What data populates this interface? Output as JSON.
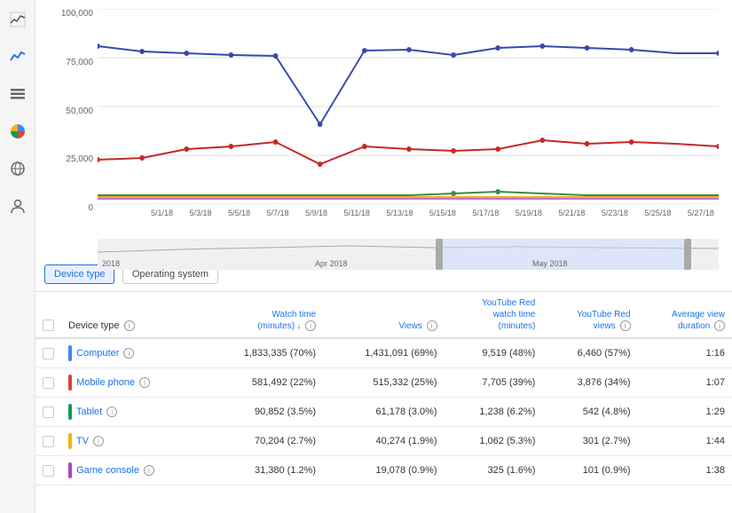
{
  "sidebar": {
    "icons": [
      {
        "name": "chart-line-icon",
        "symbol": "📈",
        "active": true
      },
      {
        "name": "trending-icon",
        "symbol": "〜"
      },
      {
        "name": "bar-chart-icon",
        "symbol": "≡"
      },
      {
        "name": "pie-chart-icon",
        "symbol": "◑"
      },
      {
        "name": "globe-icon",
        "symbol": "◎"
      },
      {
        "name": "people-icon",
        "symbol": "⚙"
      }
    ]
  },
  "chart": {
    "y_labels": [
      "100,000",
      "75,000",
      "50,000",
      "25,000",
      "0"
    ],
    "x_labels": [
      "5/1/18",
      "5/3/18",
      "5/5/18",
      "5/7/18",
      "5/9/18",
      "5/11/18",
      "5/13/18",
      "5/15/18",
      "5/17/18",
      "5/19/18",
      "5/21/18",
      "5/23/18",
      "5/25/18",
      "5/27/18"
    ],
    "timeline_labels": [
      "2018",
      "Apr 2018",
      "May 2018"
    ]
  },
  "tabs": {
    "items": [
      {
        "label": "Device type",
        "active": true
      },
      {
        "label": "Operating system",
        "active": false
      }
    ]
  },
  "table": {
    "headers": [
      {
        "label": "",
        "key": "checkbox"
      },
      {
        "label": "Device type",
        "key": "device_type"
      },
      {
        "label": "Watch time (minutes) ↓",
        "key": "watch_time"
      },
      {
        "label": "Views",
        "key": "views"
      },
      {
        "label": "YouTube Red watch time (minutes)",
        "key": "yt_red_watch"
      },
      {
        "label": "YouTube Red views",
        "key": "yt_red_views"
      },
      {
        "label": "Average view duration",
        "key": "avg_duration"
      }
    ],
    "rows": [
      {
        "device": "Computer",
        "color": "#4285f4",
        "watch_time": "1,833,335 (70%)",
        "views": "1,431,091 (69%)",
        "yt_red_watch": "9,519 (48%)",
        "yt_red_views": "6,460 (57%)",
        "avg_duration": "1:16"
      },
      {
        "device": "Mobile phone",
        "color": "#db4437",
        "watch_time": "581,492 (22%)",
        "views": "515,332 (25%)",
        "yt_red_watch": "7,705 (39%)",
        "yt_red_views": "3,876 (34%)",
        "avg_duration": "1:07"
      },
      {
        "device": "Tablet",
        "color": "#0f9d58",
        "watch_time": "90,852 (3.5%)",
        "views": "61,178 (3.0%)",
        "yt_red_watch": "1,238 (6.2%)",
        "yt_red_views": "542 (4.8%)",
        "avg_duration": "1:29"
      },
      {
        "device": "TV",
        "color": "#f4b400",
        "watch_time": "70,204 (2.7%)",
        "views": "40,274 (1.9%)",
        "yt_red_watch": "1,062 (5.3%)",
        "yt_red_views": "301 (2.7%)",
        "avg_duration": "1:44"
      },
      {
        "device": "Game console",
        "color": "#ab47bc",
        "watch_time": "31,380 (1.2%)",
        "views": "19,078 (0.9%)",
        "yt_red_watch": "325 (1.6%)",
        "yt_red_views": "101 (0.9%)",
        "avg_duration": "1:38"
      }
    ]
  }
}
